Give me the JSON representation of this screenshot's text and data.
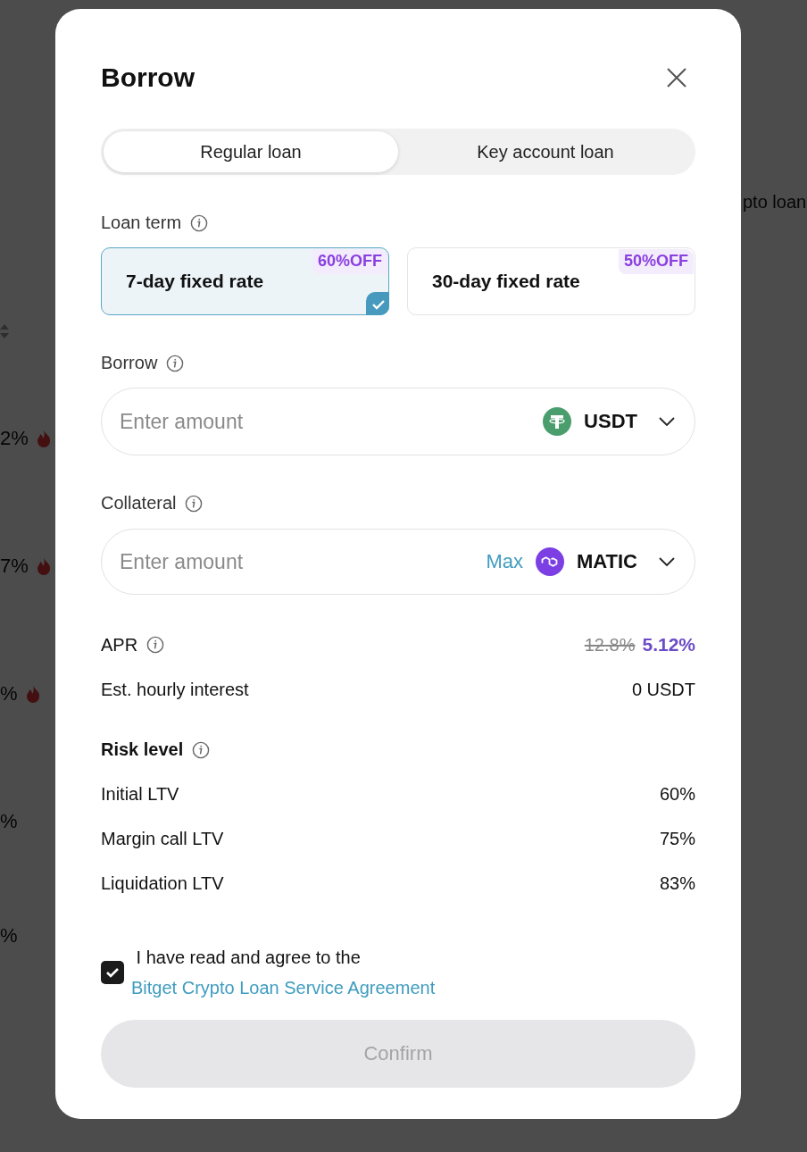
{
  "background": {
    "side_label": "pto loan",
    "rates": [
      {
        "value": "2%",
        "hot": true
      },
      {
        "value": "7%",
        "hot": true
      },
      {
        "value": "%",
        "hot": true
      },
      {
        "value": "%",
        "hot": false
      },
      {
        "value": "%",
        "hot": false
      }
    ]
  },
  "dialog": {
    "title": "Borrow",
    "tabs": [
      {
        "label": "Regular loan",
        "selected": true
      },
      {
        "label": "Key account loan",
        "selected": false
      }
    ],
    "loan_term": {
      "label": "Loan term"
    },
    "terms": [
      {
        "label": "7-day fixed rate",
        "badge": "60%OFF",
        "selected": true
      },
      {
        "label": "30-day fixed rate",
        "badge": "50%OFF",
        "selected": false
      }
    ],
    "borrow": {
      "label": "Borrow",
      "placeholder": "Enter amount",
      "currency": "USDT",
      "kind": "tether"
    },
    "collateral": {
      "label": "Collateral",
      "placeholder": "Enter amount",
      "max": "Max",
      "currency": "MATIC",
      "kind": "polygon"
    },
    "apr": {
      "label": "APR",
      "original": "12.8%",
      "value": "5.12%"
    },
    "hourly": {
      "label": "Est. hourly interest",
      "value": "0 USDT"
    },
    "risk": {
      "title": "Risk level",
      "rows": [
        {
          "label": "Initial LTV",
          "value": "60%"
        },
        {
          "label": "Margin call LTV",
          "value": "75%"
        },
        {
          "label": "Liquidation LTV",
          "value": "83%"
        }
      ]
    },
    "agreement": {
      "checked": true,
      "text": "I have read and agree to the",
      "link": "Bitget Crypto Loan Service Agreement"
    },
    "confirm": {
      "label": "Confirm",
      "disabled": true
    }
  }
}
